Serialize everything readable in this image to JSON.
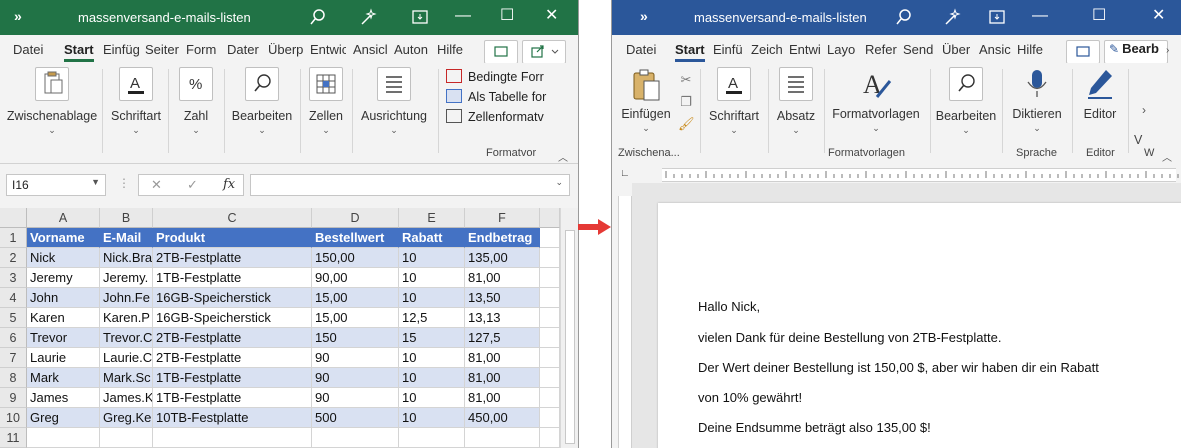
{
  "excel": {
    "title": "massenversand-e-mails-listen",
    "tabs": [
      "Datei",
      "Start",
      "Einfüg",
      "Seiter",
      "Form",
      "Dater",
      "Überp",
      "Entwic",
      "Ansicl",
      "Auton",
      "Hilfe"
    ],
    "active_tab": "Start",
    "ribbon": {
      "groups": [
        "Zwischenablage",
        "Schriftart",
        "Zahl",
        "Bearbeiten",
        "Zellen",
        "Ausrichtung"
      ],
      "styles": [
        "Bedingte Forr",
        "Als Tabelle for",
        "Zellenformatv"
      ],
      "styles_group_label": "Formatvor"
    },
    "name_box": "I16",
    "fx_label": "fx",
    "columns": [
      "A",
      "B",
      "C",
      "D",
      "E",
      "F"
    ],
    "rows": [
      [
        "Vorname",
        "E-Mail",
        "Produkt",
        "Bestellwert",
        "Rabatt",
        "Endbetrag"
      ],
      [
        "Nick",
        "Nick.Bra",
        "2TB-Festplatte",
        "150,00",
        "10",
        "135,00"
      ],
      [
        "Jeremy",
        "Jeremy.",
        "1TB-Festplatte",
        "90,00",
        "10",
        "81,00"
      ],
      [
        "John",
        "John.Fe",
        "16GB-Speicherstick",
        "15,00",
        "10",
        "13,50"
      ],
      [
        "Karen",
        "Karen.P",
        "16GB-Speicherstick",
        "15,00",
        "12,5",
        "13,13"
      ],
      [
        "Trevor",
        "Trevor.C",
        "2TB-Festplatte",
        "150",
        "15",
        "127,5"
      ],
      [
        "Laurie",
        "Laurie.C",
        "2TB-Festplatte",
        "90",
        "10",
        "81,00"
      ],
      [
        "Mark",
        "Mark.Sc",
        "1TB-Festplatte",
        "90",
        "10",
        "81,00"
      ],
      [
        "James",
        "James.K",
        "1TB-Festplatte",
        "90",
        "10",
        "81,00"
      ],
      [
        "Greg",
        " Greg.Ke",
        "10TB-Festplatte",
        "500",
        "10",
        "450,00"
      ]
    ],
    "row_numbers": [
      "1",
      "2",
      "3",
      "4",
      "5",
      "6",
      "7",
      "8",
      "9",
      "10",
      "11"
    ]
  },
  "word": {
    "title": "massenversand-e-mails-listen",
    "tabs": [
      "Datei",
      "Start",
      "Einfü",
      "Zeich",
      "Entwi",
      "Layo",
      "Refer",
      "Send",
      "Über",
      "Ansic",
      "Hilfe"
    ],
    "active_tab": "Start",
    "edit_button": "Bearb",
    "ribbon": {
      "paste": "Einfügen",
      "font": "Schriftart",
      "paragraph": "Absatz",
      "styles": "Formatvorlagen",
      "editing": "Bearbeiten",
      "dictate": "Diktieren",
      "editor": "Editor",
      "more": "V"
    },
    "group_labels": [
      "Zwischena...",
      "Formatvorlagen",
      "Sprache",
      "Editor",
      "W"
    ],
    "document": [
      "Hallo Nick,",
      "vielen Dank für deine Bestellung von 2TB-Festplatte.",
      "Der Wert deiner Bestellung ist 150,00 $, aber wir haben dir ein Rabatt",
      "von 10% gewährt!",
      "Deine Endsumme beträgt also 135,00 $!"
    ]
  },
  "colors": {
    "excel_green": "#217346",
    "word_blue": "#2b579a",
    "table_header": "#4472c4",
    "table_band": "#d9e1f2",
    "arrow": "#e53935"
  }
}
